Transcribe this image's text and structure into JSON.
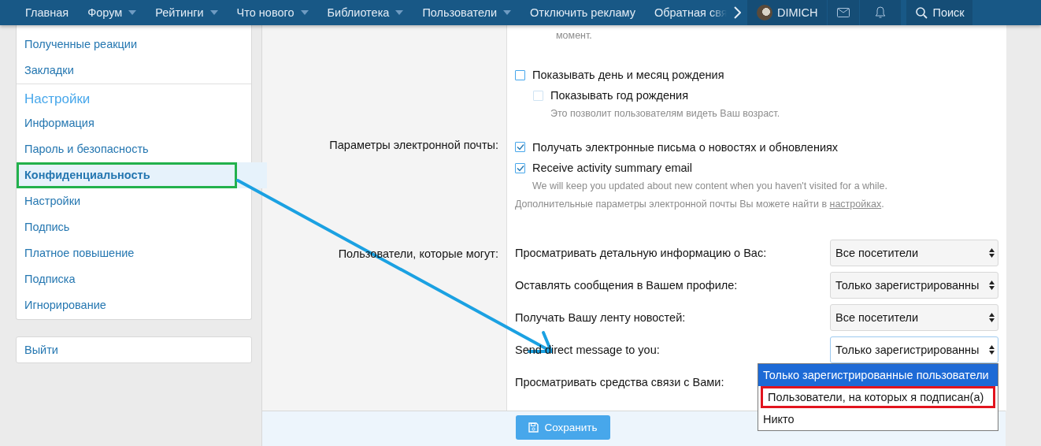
{
  "nav": {
    "items": [
      {
        "label": "Главная",
        "dropdown": false
      },
      {
        "label": "Форум",
        "dropdown": true
      },
      {
        "label": "Рейтинги",
        "dropdown": true
      },
      {
        "label": "Что нового",
        "dropdown": true
      },
      {
        "label": "Библиотека",
        "dropdown": true
      },
      {
        "label": "Пользователи",
        "dropdown": true
      },
      {
        "label": "Отключить рекламу",
        "dropdown": false
      },
      {
        "label": "Обратная свя",
        "dropdown": false
      }
    ],
    "user": {
      "name": "DIMICH"
    },
    "search": {
      "label": "Поиск"
    }
  },
  "sidebar": {
    "top_items": [
      {
        "label": "Полученные реакции",
        "selected": false,
        "annotated": false
      },
      {
        "label": "Закладки",
        "selected": false,
        "annotated": false
      }
    ],
    "heading": "Настройки",
    "items": [
      {
        "label": "Информация",
        "selected": false,
        "annotated": false
      },
      {
        "label": "Пароль и безопасность",
        "selected": false,
        "annotated": false
      },
      {
        "label": "Конфиденциальность",
        "selected": true,
        "annotated": true
      },
      {
        "label": "Настройки",
        "selected": false,
        "annotated": false
      },
      {
        "label": "Подпись",
        "selected": false,
        "annotated": false
      },
      {
        "label": "Платное повышение",
        "selected": false,
        "annotated": false
      },
      {
        "label": "Подписка",
        "selected": false,
        "annotated": false
      },
      {
        "label": "Игнорирование",
        "selected": false,
        "annotated": false
      }
    ],
    "logout": "Выйти"
  },
  "form": {
    "top_note": "момент.",
    "birthday": {
      "checkboxes": [
        {
          "label": "Показывать день и месяц рождения",
          "checked": false,
          "disabled": false,
          "children": [
            {
              "label": "Показывать год рождения",
              "checked": false,
              "disabled": true,
              "hint": "Это позволит пользователям видеть Ваш возраст."
            }
          ]
        }
      ]
    },
    "email": {
      "label": "Параметры электронной почты:",
      "checkboxes": [
        {
          "label": "Получать электронные письма о новостях и обновлениях",
          "checked": true,
          "disabled": false
        },
        {
          "label": "Receive activity summary email",
          "checked": true,
          "disabled": false,
          "hint": "We will keep you updated about new content when you haven't visited for a while."
        }
      ],
      "note": {
        "text_before": "Дополнительные параметры электронной почты Вы можете найти в ",
        "link": "настройках",
        "text_after": "."
      }
    },
    "privacy": {
      "label": "Пользователи, которые могут:",
      "rows": [
        {
          "label": "Просматривать детальную информацию о Вас:",
          "value": "Все посетители",
          "focused": false,
          "open": false
        },
        {
          "label": "Оставлять сообщения в Вашем профиле:",
          "value": "Только зарегистрированны",
          "focused": false,
          "open": false
        },
        {
          "label": "Получать Вашу ленту новостей:",
          "value": "Все посетители",
          "focused": false,
          "open": false
        },
        {
          "label": "Send direct message to you:",
          "value": "Только зарегистрированны",
          "focused": true,
          "open": true,
          "options": [
            {
              "label": "Только зарегистрированные пользователи",
              "selected": true,
              "annotated": false
            },
            {
              "label": "Пользователи, на которых я подписан(а)",
              "selected": false,
              "annotated": true
            },
            {
              "label": "Никто",
              "selected": false,
              "annotated": false
            }
          ]
        },
        {
          "label": "Просматривать средства связи с Вами:",
          "open": false
        }
      ]
    },
    "save_button": "Сохранить"
  }
}
